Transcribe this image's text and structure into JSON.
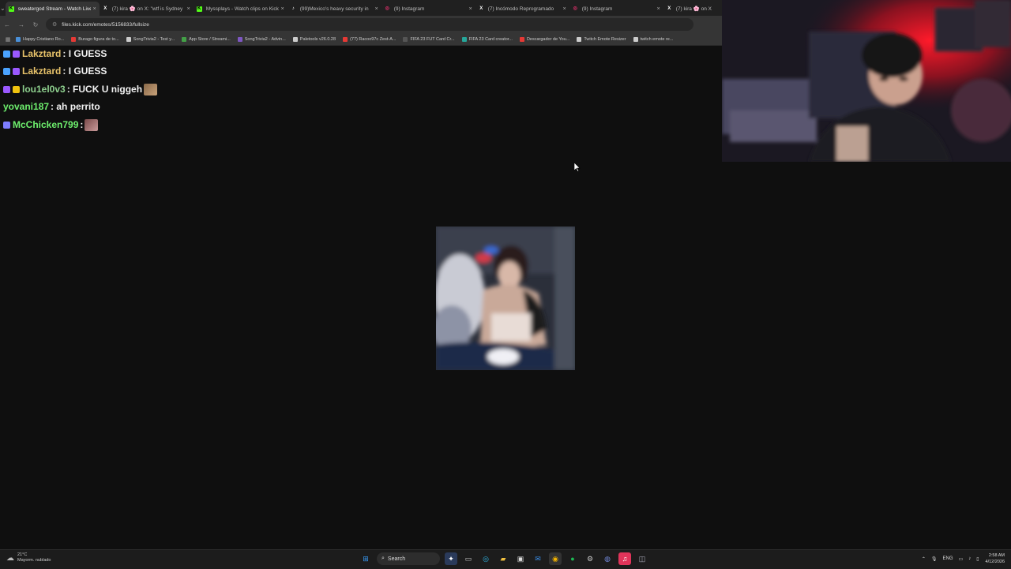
{
  "browser": {
    "tabs": [
      {
        "title": "sweatergod Stream - Watch Live",
        "icon": "kick-icon",
        "color": "#53fc18",
        "active": true
      },
      {
        "title": "(7) kira 🌸 on X: \"wtf is Sydney",
        "icon": "x-icon",
        "color": "#ffffff",
        "active": false
      },
      {
        "title": "Myssplays - Watch clips on Kick",
        "icon": "kick-icon",
        "color": "#53fc18",
        "active": false
      },
      {
        "title": "(99)Mexico's heavy security in",
        "icon": "tiktok-icon",
        "color": "#ffffff",
        "active": false
      },
      {
        "title": "(9) Instagram",
        "icon": "instagram-icon",
        "color": "#e1306c",
        "active": false
      },
      {
        "title": "(7) Incómodo Reprogramado",
        "icon": "x-icon",
        "color": "#ffffff",
        "active": false
      },
      {
        "title": "(9) Instagram",
        "icon": "instagram-icon",
        "color": "#e1306c",
        "active": false
      },
      {
        "title": "(7) kira 🌸 on X",
        "icon": "x-icon",
        "color": "#ffffff",
        "active": false
      }
    ],
    "url": "files.kick.com/emotes/5156833/fullsize",
    "bookmarks": [
      {
        "label": "Happy Cristiano Ro...",
        "color": "#4a90d9"
      },
      {
        "label": "Burago figura de to...",
        "color": "#e53935"
      },
      {
        "label": "SongTrivia2 - Test y...",
        "color": "#cccccc"
      },
      {
        "label": "App Store / Streami...",
        "color": "#43a047"
      },
      {
        "label": "SongTrivia2 - Advin...",
        "color": "#7e57c2"
      },
      {
        "label": "Paletools v26.0.28",
        "color": "#cccccc"
      },
      {
        "label": "(77) Racoo97c Zest-A...",
        "color": "#e53935"
      },
      {
        "label": "FIFA 23 FUT Card Cr...",
        "color": "#555555"
      },
      {
        "label": "FIFA 23 Card creator...",
        "color": "#26a69a"
      },
      {
        "label": "Descargador de You...",
        "color": "#e53935"
      },
      {
        "label": "Twitch Emote Resizer",
        "color": "#cccccc"
      },
      {
        "label": "twitch emote re...",
        "color": "#cccccc"
      }
    ]
  },
  "chat": [
    {
      "user": "Lakztard",
      "text": ": I GUESS",
      "color": "#e8c36a",
      "badges": [
        "#4aa3ff",
        "#9b59ff"
      ],
      "emote": false
    },
    {
      "user": "Lakztard",
      "text": ": I GUESS",
      "color": "#e8c36a",
      "badges": [
        "#4aa3ff",
        "#9b59ff"
      ],
      "emote": false
    },
    {
      "user": "lou1el0v3",
      "text": ": FUCK U niggeh",
      "color": "#8fd18f",
      "badges": [
        "#9b59ff",
        "#f1c40f"
      ],
      "emote": true
    },
    {
      "user": "yovani187",
      "text": ": ah perrito",
      "color": "#6ef06e",
      "badges": [],
      "emote": false
    },
    {
      "user": "McChicken799",
      "text": ":",
      "color": "#6ef06e",
      "badges": [
        "#7d7dff"
      ],
      "emote": true
    }
  ],
  "taskbar": {
    "weather_temp": "21°C",
    "weather_desc": "Mayorm. nublado",
    "search_label": "Search",
    "lang": "ENG",
    "time": "2:58 AM",
    "date": "4/12/2026"
  }
}
